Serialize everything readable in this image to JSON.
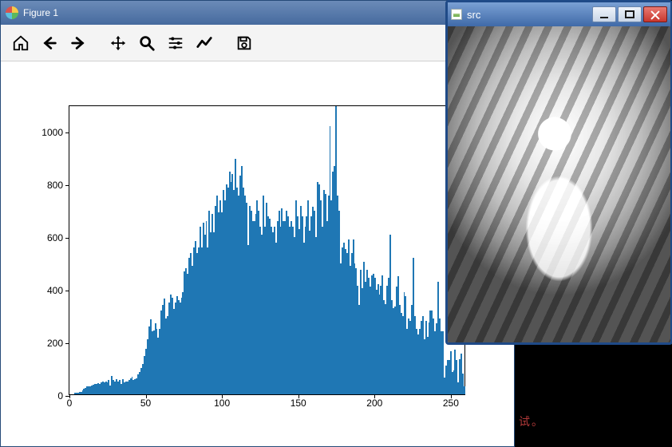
{
  "figure_window": {
    "title": "Figure 1",
    "toolbar": {
      "home": "home-icon",
      "back": "back-icon",
      "forward": "forward-icon",
      "pan": "pan-icon",
      "zoom": "zoom-icon",
      "configure": "sliders-icon",
      "edit": "edit-icon",
      "save": "save-icon"
    }
  },
  "src_window": {
    "title": "src"
  },
  "background_text": "试。",
  "chart_data": {
    "type": "bar",
    "title": "",
    "xlabel": "",
    "ylabel": "",
    "xlim": [
      0,
      260
    ],
    "ylim": [
      0,
      1100
    ],
    "xticks": [
      0,
      50,
      100,
      150,
      200,
      250
    ],
    "yticks": [
      0,
      200,
      400,
      600,
      800,
      1000
    ],
    "categories_note": "grayscale intensity bins 0..255",
    "values": [
      0,
      0,
      0,
      5,
      5,
      5,
      8,
      10,
      15,
      20,
      25,
      30,
      30,
      30,
      35,
      38,
      40,
      40,
      42,
      40,
      45,
      48,
      45,
      50,
      45,
      55,
      35,
      70,
      55,
      50,
      58,
      50,
      55,
      40,
      58,
      45,
      50,
      48,
      55,
      60,
      68,
      55,
      58,
      60,
      75,
      85,
      100,
      115,
      145,
      175,
      210,
      260,
      285,
      240,
      245,
      270,
      250,
      215,
      250,
      320,
      340,
      365,
      290,
      300,
      350,
      380,
      370,
      325,
      350,
      375,
      360,
      350,
      370,
      390,
      470,
      480,
      460,
      520,
      540,
      490,
      560,
      585,
      540,
      560,
      640,
      560,
      655,
      610,
      660,
      560,
      700,
      620,
      690,
      620,
      720,
      760,
      695,
      740,
      695,
      780,
      740,
      800,
      790,
      850,
      810,
      840,
      780,
      900,
      790,
      760,
      835,
      870,
      790,
      760,
      730,
      570,
      720,
      700,
      660,
      660,
      690,
      740,
      700,
      640,
      610,
      760,
      640,
      730,
      680,
      670,
      640,
      620,
      640,
      580,
      660,
      700,
      640,
      710,
      660,
      660,
      700,
      680,
      640,
      660,
      640,
      600,
      740,
      680,
      630,
      720,
      680,
      580,
      640,
      680,
      740,
      625,
      680,
      715,
      700,
      600,
      810,
      800,
      740,
      640,
      780,
      765,
      660,
      760,
      1025,
      740,
      850,
      870,
      1100,
      760,
      700,
      500,
      560,
      580,
      555,
      540,
      590,
      490,
      540,
      590,
      500,
      480,
      415,
      340,
      475,
      405,
      505,
      430,
      475,
      445,
      410,
      455,
      460,
      445,
      400,
      420,
      380,
      415,
      455,
      360,
      345,
      415,
      445,
      610,
      360,
      330,
      335,
      410,
      450,
      340,
      310,
      300,
      390,
      375,
      250,
      290,
      280,
      340,
      520,
      300,
      250,
      230,
      250,
      280,
      300,
      210,
      280,
      220,
      275,
      320,
      320,
      290,
      240,
      270,
      430,
      290,
      240,
      240,
      65,
      110,
      130,
      130,
      165,
      85,
      90,
      170,
      130,
      45,
      135,
      155,
      80,
      30
    ]
  }
}
